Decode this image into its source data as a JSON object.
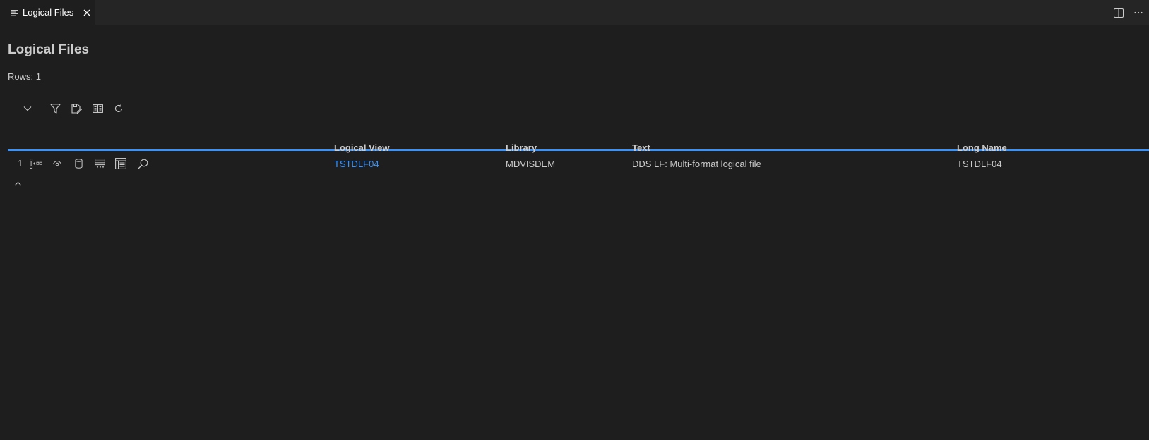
{
  "tab": {
    "label": "Logical Files"
  },
  "page": {
    "title": "Logical Files",
    "rows_label": "Rows: 1"
  },
  "table": {
    "headers": [
      "Logical View",
      "Library",
      "Text",
      "Long Name"
    ],
    "rows": [
      {
        "num": "1",
        "logical_view": "TSTDLF04",
        "library": "MDVISDEM",
        "text": "DDS LF: Multi-format logical file",
        "long_name": "TSTDLF04"
      }
    ]
  },
  "icons": {
    "tab": "list-icon",
    "close": "close-icon",
    "split": "split-editor-icon",
    "more": "ellipsis-icon",
    "toolbar": [
      "chevron-down-icon",
      "filter-icon",
      "edit-tag-icon",
      "book-icon",
      "refresh-icon"
    ],
    "row_actions": [
      "hierarchy-icon",
      "eye-icon",
      "database-icon",
      "table-keys-icon",
      "record-format-icon",
      "search-icon"
    ],
    "collapse": "chevron-up-icon"
  },
  "colors": {
    "background": "#1e1e1e",
    "accent": "#3794ff",
    "tabbar": "#252526"
  }
}
